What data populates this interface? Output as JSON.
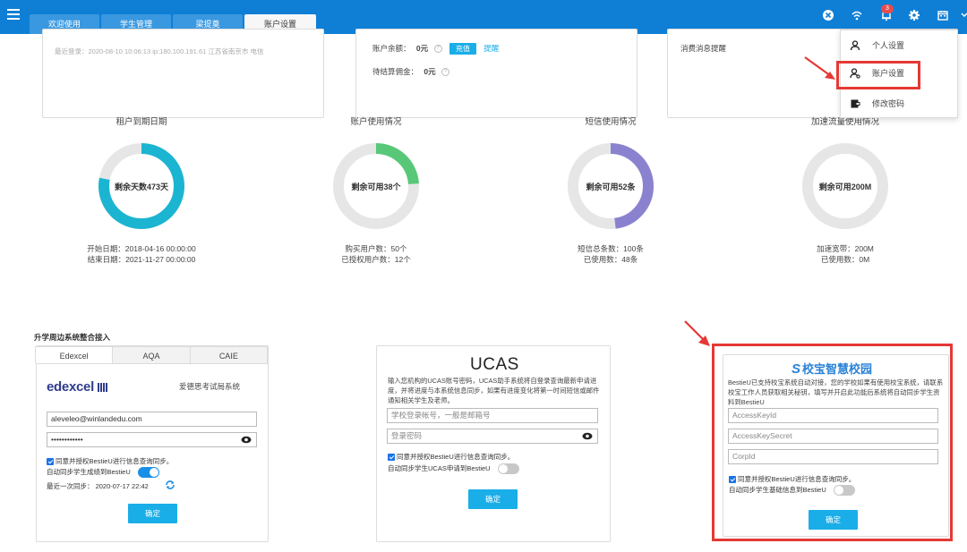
{
  "topbar": {
    "tabs": [
      "欢迎使用",
      "学生管理",
      "梁提奠",
      "账户设置"
    ],
    "active_tab": 3,
    "notification_count": "3"
  },
  "dropdown": {
    "items": [
      {
        "label": "个人设置",
        "icon": "user-icon"
      },
      {
        "label": "账户设置",
        "icon": "account-icon"
      },
      {
        "label": "修改密码",
        "icon": "password-icon"
      }
    ]
  },
  "cards": {
    "login": "最近登录：2020-08-10 10:06:13 ip:180.100.191.61 江苏省南京市 电信",
    "balance_label": "账户余额：",
    "balance_value": "0元",
    "recharge_label": "充值",
    "remind_label": "提醒",
    "pending_label": "待结算佣金：",
    "pending_value": "0元",
    "notify_label": "消费消息提醒"
  },
  "stats": [
    {
      "title": "租户到期日期",
      "center": "剩余天数473天",
      "lines": [
        "开始日期：2018-04-16 00:00:00",
        "结束日期：2021-11-27 00:00:00"
      ],
      "progress": 0.78,
      "color": "#1bb5d1"
    },
    {
      "title": "账户使用情况",
      "center": "剩余可用38个",
      "lines": [
        "购买用户数：50个",
        "已授权用户数：12个"
      ],
      "progress": 0.24,
      "color": "#58c878"
    },
    {
      "title": "短信使用情况",
      "center": "剩余可用52条",
      "lines": [
        "短信总条数：100条",
        "已使用数：48条"
      ],
      "progress": 0.48,
      "color": "#8b82cf"
    },
    {
      "title": "加速流量使用情况",
      "center": "剩余可用200M",
      "lines": [
        "加速宽带：200M",
        "已使用数：0M"
      ],
      "progress": 0,
      "color": "#1bb5d1"
    }
  ],
  "integration": {
    "title": "升学周边系统整合接入",
    "tabs": [
      "Edexcel",
      "AQA",
      "CAIE"
    ],
    "active_tab": 0,
    "edexcel": {
      "logo": "edexcel",
      "system_name": "爱德思考试局系统",
      "email": "aleveleo@winlandedu.com",
      "password": "••••••••••••",
      "agree": "同意并授权BestieU进行信息查询同步。",
      "auto_sync": "自动同步学生成绩到BestieU",
      "last_sync": "最近一次同步：  2020-07-17 22:42",
      "confirm": "确定"
    },
    "ucas": {
      "logo": "UCAS",
      "desc": "输入您机构的UCAS账号密码，UCAS助手系统将自登录查询最新申请进度，并将进度与本系统信息同步，如果有进度变化将第一时间短信或邮件通知相关学生及老师。",
      "account_placeholder": "学校登录帐号，一般是邮箱号",
      "password_placeholder": "登录密码",
      "agree": "同意并授权BestieU进行信息查询同步。",
      "auto_sync": "自动同步学生UCAS申请到BestieU",
      "confirm": "确定"
    },
    "xiaobao": {
      "logo_mark": "S",
      "logo_text": "校宝智慧校园",
      "desc": "BestieU已支持校宝系统自动对接，您的学校如果有使用校宝系统，请联系校宝工作人员获取相关秘钥，填写并开启此功能后系统将自动同步学生资料到BestieU",
      "key_id_placeholder": "AccessKeyId",
      "key_secret_placeholder": "AccessKeySecret",
      "corp_id_placeholder": "CorpId",
      "agree": "同意并授权BestieU进行信息查询同步。",
      "auto_sync": "自动同步学生基础信息到BestieU",
      "confirm": "确定"
    }
  },
  "colors": {
    "topbar": "#0f7fd6",
    "button": "#1aaee8",
    "highlight": "#e53935"
  }
}
